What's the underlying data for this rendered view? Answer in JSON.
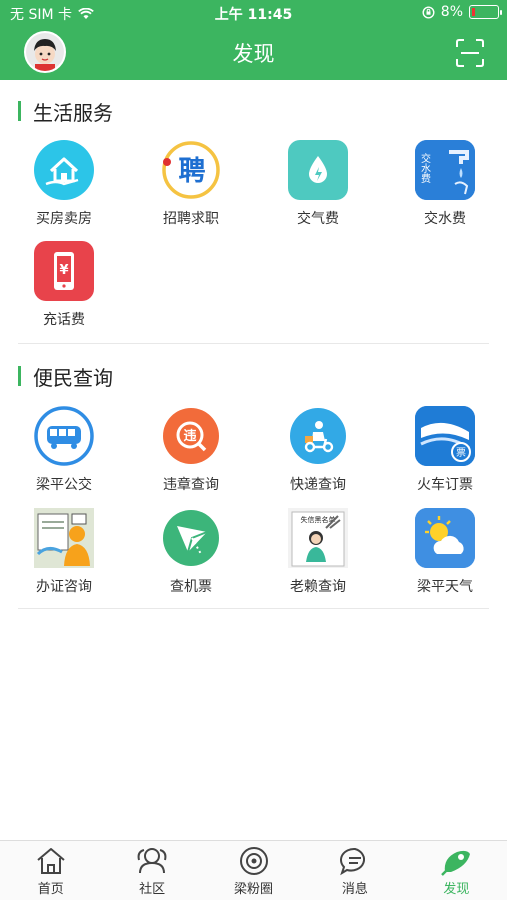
{
  "status": {
    "carrier": "无 SIM 卡",
    "time": "上午 11:45",
    "battery": "8%"
  },
  "header": {
    "title": "发现"
  },
  "sections": [
    {
      "title": "生活服务",
      "items": [
        {
          "label": "买房卖房",
          "icon": "house-icon"
        },
        {
          "label": "招聘求职",
          "icon": "recruit-icon",
          "glyph": "聘"
        },
        {
          "label": "交气费",
          "icon": "gas-drop-icon"
        },
        {
          "label": "交水费",
          "icon": "water-fee-icon",
          "glyph": "交水费"
        },
        {
          "label": "充话费",
          "icon": "phone-recharge-icon",
          "glyph": "¥"
        }
      ]
    },
    {
      "title": "便民查询",
      "items": [
        {
          "label": "梁平公交",
          "icon": "bus-icon"
        },
        {
          "label": "违章查询",
          "icon": "violation-icon",
          "glyph": "违"
        },
        {
          "label": "快递查询",
          "icon": "courier-icon"
        },
        {
          "label": "火车订票",
          "icon": "train-icon",
          "glyph": "票"
        },
        {
          "label": "办证咨询",
          "icon": "certificate-icon"
        },
        {
          "label": "查机票",
          "icon": "paper-plane-icon"
        },
        {
          "label": "老赖查询",
          "icon": "debtor-icon",
          "glyph": "失信黑名单"
        },
        {
          "label": "梁平天气",
          "icon": "weather-icon"
        }
      ]
    }
  ],
  "tabs": [
    {
      "label": "首页",
      "icon": "home-icon",
      "active": false
    },
    {
      "label": "社区",
      "icon": "community-icon",
      "active": false
    },
    {
      "label": "梁粉圈",
      "icon": "circle-icon",
      "active": false
    },
    {
      "label": "消息",
      "icon": "message-icon",
      "active": false
    },
    {
      "label": "发现",
      "icon": "discover-icon",
      "active": true
    }
  ],
  "colors": {
    "brand_green": "#3cb560"
  }
}
